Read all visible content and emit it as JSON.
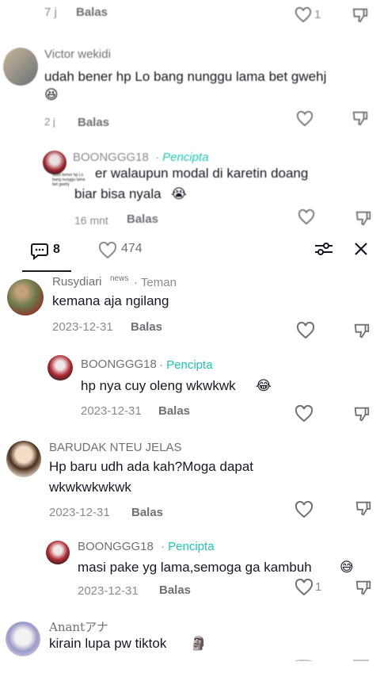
{
  "top_video_overlay": {
    "row1": {
      "time": "7 j",
      "reply": "Balas",
      "likes": "1"
    },
    "comment_victor": {
      "name": "Victor wekidi",
      "text": "udah bener hp Lo bang nunggu lama bet gwehj",
      "emoji": "😆",
      "time": "2 j",
      "reply": "Balas"
    },
    "reply_video": {
      "name": "BOONGGG18",
      "badge": "· Pencipta",
      "thumb_caption": "udah bener hp Lo bang nunggu lama bet gwehj",
      "text_line1": "er walaupun modal di karetin doang",
      "text_line2": "biar bisa nyala",
      "emoji": "😭",
      "time": "16 mnt",
      "reply": "Balas"
    }
  },
  "tabs": {
    "comments_count": "8",
    "likes_count": "474"
  },
  "comments": [
    {
      "name": "Rusydiari",
      "name_sup": "news",
      "relation": "· Teman",
      "text": "kemana aja ngilang",
      "date": "2023-12-31",
      "reply": "Balas"
    },
    {
      "name": "BOONGGG18",
      "badge": "· Pencipta",
      "text": "hp nya cuy oleng wkwkwk",
      "emoji": "😂",
      "date": "2023-12-31",
      "reply": "Balas"
    },
    {
      "name": "BARUDAK NTEU JELAS",
      "text_line1": "Hp baru udh ada kah?Moga dapat",
      "text_line2": "wkwkwkwkwk",
      "date": "2023-12-31",
      "reply": "Balas"
    },
    {
      "name": "BOONGGG18",
      "badge": "· Pencipta",
      "text": "masi pake yg lama,semoga ga kambuh",
      "emoji": "😅",
      "date": "2023-12-31",
      "reply": "Balas",
      "likes": "1"
    },
    {
      "name": "Anantアナ",
      "text": "kirain lupa pw tiktok",
      "emoji": "🗿"
    }
  ],
  "colors": {
    "text": "#161823",
    "meta": "#8a8b91",
    "creator": "#20c5b3"
  },
  "icons": [
    "heart-icon",
    "dislike-icon",
    "comment-icon",
    "filter-icon",
    "close-icon"
  ]
}
